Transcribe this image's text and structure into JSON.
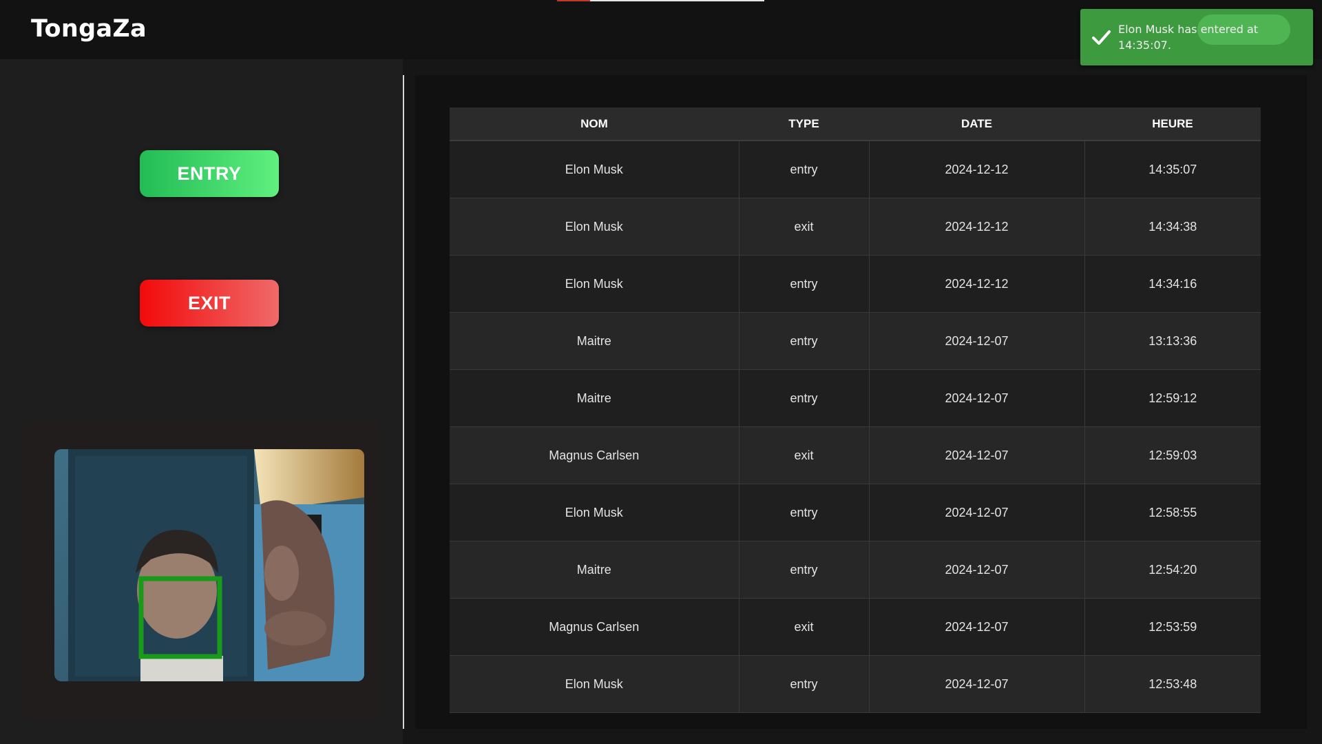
{
  "app": {
    "title": "TongaZa"
  },
  "loading_bar": {
    "progress": 0.16
  },
  "actions": {
    "entry_label": "ENTRY",
    "exit_label": "EXIT"
  },
  "camera": {
    "face_detected": true,
    "face_box_color": "#1a9a1a"
  },
  "table": {
    "headers": [
      "NOM",
      "TYPE",
      "DATE",
      "HEURE"
    ],
    "rows": [
      [
        "Elon Musk",
        "entry",
        "2024-12-12",
        "14:35:07"
      ],
      [
        "Elon Musk",
        "exit",
        "2024-12-12",
        "14:34:38"
      ],
      [
        "Elon Musk",
        "entry",
        "2024-12-12",
        "14:34:16"
      ],
      [
        "Maitre",
        "entry",
        "2024-12-07",
        "13:13:36"
      ],
      [
        "Maitre",
        "entry",
        "2024-12-07",
        "12:59:12"
      ],
      [
        "Magnus Carlsen",
        "exit",
        "2024-12-07",
        "12:59:03"
      ],
      [
        "Elon Musk",
        "entry",
        "2024-12-07",
        "12:58:55"
      ],
      [
        "Maitre",
        "entry",
        "2024-12-07",
        "12:54:20"
      ],
      [
        "Magnus Carlsen",
        "exit",
        "2024-12-07",
        "12:53:59"
      ],
      [
        "Elon Musk",
        "entry",
        "2024-12-07",
        "12:53:48"
      ]
    ]
  },
  "toast": {
    "message": "Elon Musk has entered at 14:35:07.",
    "icon": "checkmark-icon",
    "color": "#3d9a3f"
  },
  "colors": {
    "entry_button": "#22bb55",
    "exit_button": "#f20a0a",
    "background": "#161616"
  }
}
